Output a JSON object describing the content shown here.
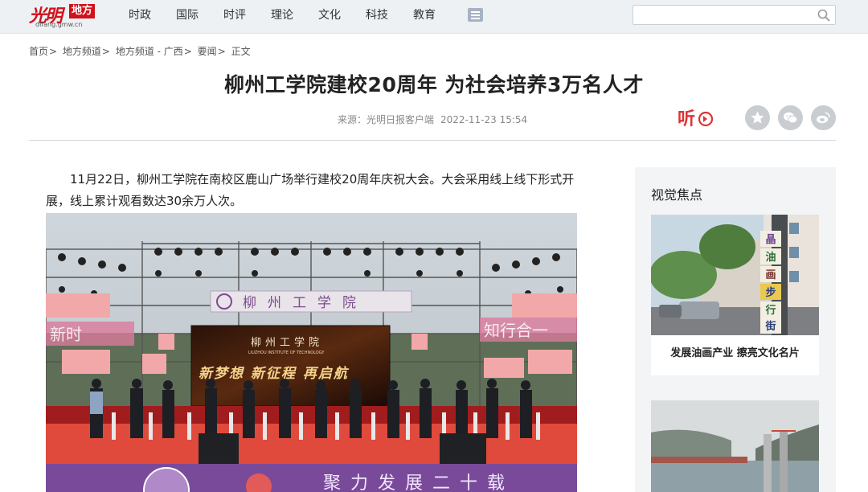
{
  "logo": {
    "mark": "光明",
    "box": "地方",
    "url": "difang.gmw.cn"
  },
  "nav": {
    "items": [
      "时政",
      "国际",
      "时评",
      "理论",
      "文化",
      "科技",
      "教育"
    ]
  },
  "search": {
    "placeholder": ""
  },
  "breadcrumb": [
    {
      "label": "首页"
    },
    {
      "label": "地方频道"
    },
    {
      "label": "地方频道 - 广西"
    },
    {
      "label": "要闻"
    },
    {
      "label": "正文"
    }
  ],
  "article": {
    "title": "柳州工学院建校20周年 为社会培养3万名人才",
    "source": "来源：光明日报客户端",
    "date": "2022-11-23 15:54",
    "paragraph": "11月22日，柳州工学院在南校区鹿山广场举行建校20周年庆祝大会。大会采用线上线下形式开展，线上累计观看数达30余万人次。",
    "photo": {
      "sign_top": "柳州工学院",
      "screen_school": "柳州工学院",
      "screen_english": "LIUZHOU INSTITUTE OF TECHNOLOGY",
      "screen_slogan": "新梦想 新征程 再启航",
      "side_left": "新时",
      "side_right": "知行合一",
      "banner_bottom": "聚力发展二十载"
    }
  },
  "sidebar": {
    "title": "视觉焦点",
    "cards": [
      {
        "caption": "发展油画产业 擦亮文化名片",
        "sign_chars": [
          "晶",
          "油",
          "画",
          "步",
          "行",
          "街"
        ]
      },
      {
        "caption": ""
      }
    ]
  },
  "colors": {
    "brand_red": "#d0121b",
    "topbar_bg": "#eef1f4",
    "sidebar_bg": "#f3f4f6"
  },
  "icons": [
    "menu-icon",
    "search-icon",
    "listen-icon",
    "star-icon",
    "wechat-icon",
    "weibo-icon"
  ]
}
